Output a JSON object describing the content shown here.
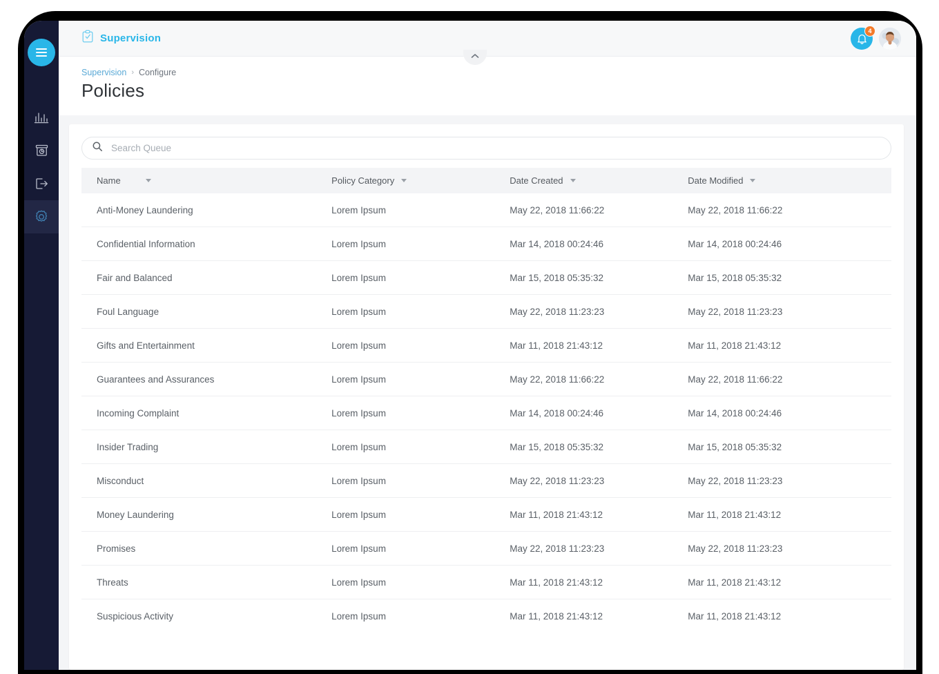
{
  "app": {
    "brand_name": "Supervision",
    "brand_icon": "clipboard-check-icon",
    "accent_color": "#29b6e8",
    "sidebar_color": "#161a35",
    "badge_color": "#f47a29"
  },
  "sidebar": {
    "menu_toggle_icon": "hamburger-menu-icon",
    "items": [
      {
        "icon": "bar-chart-icon",
        "name": "analytics",
        "active": false
      },
      {
        "icon": "archive-clock-icon",
        "name": "archive",
        "active": false
      },
      {
        "icon": "logout-arrow-icon",
        "name": "logout",
        "active": false
      },
      {
        "icon": "gear-icon",
        "name": "settings",
        "active": true
      }
    ]
  },
  "topbar": {
    "notification_icon": "bell-icon",
    "notification_count": "4",
    "avatar_icon": "user-avatar"
  },
  "header": {
    "breadcrumb": {
      "root": "Supervision",
      "separator": "›",
      "current": "Configure"
    },
    "title": "Policies",
    "collapse_icon": "chevron-up-icon"
  },
  "search": {
    "icon": "search-icon",
    "placeholder": "Search Queue",
    "value": ""
  },
  "table": {
    "columns": [
      {
        "label": "Name",
        "sort_icon": "caret-down-icon"
      },
      {
        "label": "Policy Category",
        "sort_icon": "caret-down-icon"
      },
      {
        "label": "Date Created",
        "sort_icon": "caret-down-icon"
      },
      {
        "label": "Date Modified",
        "sort_icon": "caret-down-icon"
      }
    ],
    "rows": [
      {
        "name": "Anti-Money Laundering",
        "category": "Lorem Ipsum",
        "created": "May 22, 2018 11:66:22",
        "modified": "May 22, 2018 11:66:22"
      },
      {
        "name": "Confidential Information",
        "category": "Lorem Ipsum",
        "created": "Mar 14, 2018 00:24:46",
        "modified": "Mar 14, 2018 00:24:46"
      },
      {
        "name": "Fair and Balanced",
        "category": "Lorem Ipsum",
        "created": "Mar 15, 2018 05:35:32",
        "modified": "Mar 15, 2018 05:35:32"
      },
      {
        "name": "Foul Language",
        "category": "Lorem Ipsum",
        "created": "May 22, 2018 11:23:23",
        "modified": "May 22, 2018 11:23:23"
      },
      {
        "name": "Gifts and Entertainment",
        "category": "Lorem Ipsum",
        "created": "Mar 11, 2018 21:43:12",
        "modified": "Mar 11, 2018 21:43:12"
      },
      {
        "name": "Guarantees and Assurances",
        "category": "Lorem Ipsum",
        "created": "May 22, 2018 11:66:22",
        "modified": "May 22, 2018 11:66:22"
      },
      {
        "name": "Incoming Complaint",
        "category": "Lorem Ipsum",
        "created": "Mar 14, 2018 00:24:46",
        "modified": "Mar 14, 2018 00:24:46"
      },
      {
        "name": "Insider Trading",
        "category": "Lorem Ipsum",
        "created": "Mar 15, 2018 05:35:32",
        "modified": "Mar 15, 2018 05:35:32"
      },
      {
        "name": "Misconduct",
        "category": "Lorem Ipsum",
        "created": "May 22, 2018 11:23:23",
        "modified": "May 22, 2018 11:23:23"
      },
      {
        "name": "Money Laundering",
        "category": "Lorem Ipsum",
        "created": "Mar 11, 2018 21:43:12",
        "modified": "Mar 11, 2018 21:43:12"
      },
      {
        "name": "Promises",
        "category": "Lorem Ipsum",
        "created": "May 22, 2018 11:23:23",
        "modified": "May 22, 2018 11:23:23"
      },
      {
        "name": "Threats",
        "category": "Lorem Ipsum",
        "created": "Mar 11, 2018 21:43:12",
        "modified": "Mar 11, 2018 21:43:12"
      },
      {
        "name": "Suspicious Activity",
        "category": "Lorem Ipsum",
        "created": "Mar 11, 2018 21:43:12",
        "modified": "Mar 11, 2018 21:43:12"
      }
    ]
  }
}
